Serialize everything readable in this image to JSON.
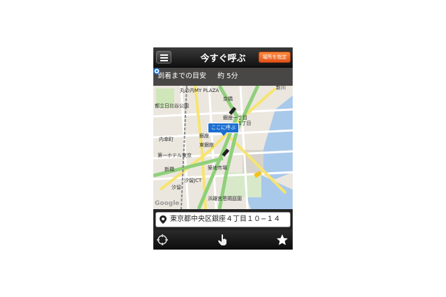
{
  "header": {
    "title": "今すぐ呼ぶ",
    "set_location_label": "場所を指定"
  },
  "eta": {
    "label": "到着までの目安",
    "value": "約 5分"
  },
  "map": {
    "labels": {
      "marunouchi": "丸の内MY PLAZA",
      "kyobashi": "京橋",
      "hibiya_park": "都立日比谷公園",
      "ginza_itchome": "銀座一丁目",
      "ginza": "銀座",
      "higashi_ginza": "東銀座",
      "uchisaiwaicho": "内幸町",
      "daiichi_hotel": "第一ホテル東京",
      "shimbashi": "新橋",
      "tsukiji": "築地市場",
      "shiodome_jct": "汐留JCT",
      "shiodome": "汐留",
      "hamarikyu": "浜離宮恩賜庭園",
      "ichome": "1丁目",
      "shinkawa": "新川"
    },
    "callout": "ここに呼ぶ",
    "attribution": "Google"
  },
  "address": {
    "value": "東京都中央区銀座４丁目１０−１４"
  },
  "tabs": {
    "icons": [
      "crosshair-icon",
      "hand-pointer-icon",
      "star-icon"
    ]
  },
  "colors": {
    "accent": "#ef6a26",
    "callout": "#1c6fd1",
    "road_green": "#8fd07b",
    "road_yellow": "#f7e46f",
    "water": "#a9c9ea"
  }
}
